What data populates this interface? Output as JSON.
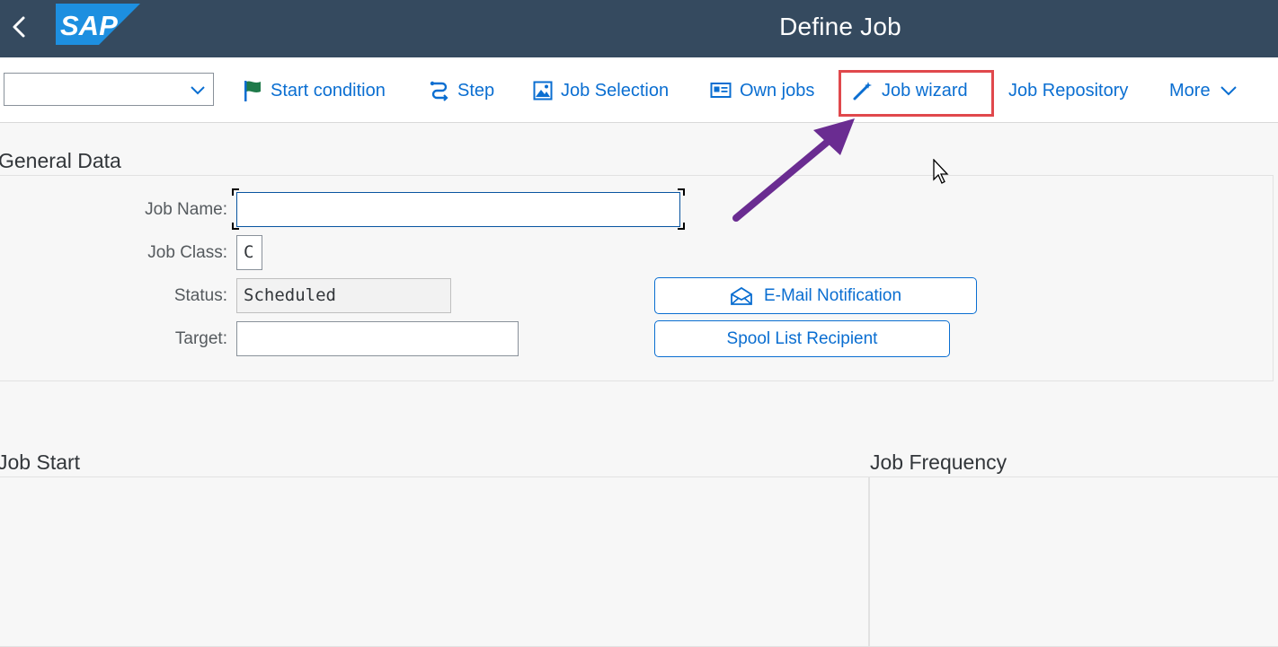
{
  "shell": {
    "title": "Define Job",
    "logo_text": "SAP",
    "colors": {
      "shellbar": "#354a5f",
      "logo": "#1d8fe0",
      "link": "#0a6ed1",
      "highlight": "#e0484c",
      "annotation_arrow": "#6a2c91"
    }
  },
  "toolbar": {
    "select_value": "",
    "items": [
      {
        "label": "Start condition",
        "icon": "flag-icon"
      },
      {
        "label": "Step",
        "icon": "step-icon"
      },
      {
        "label": "Job Selection",
        "icon": "image-icon"
      },
      {
        "label": "Own jobs",
        "icon": "id-card-icon"
      },
      {
        "label": "Job wizard",
        "icon": "magic-wand-icon"
      },
      {
        "label": "Job Repository",
        "icon": ""
      },
      {
        "label": "More",
        "icon": "chevron-down-icon"
      }
    ]
  },
  "general_data": {
    "title": "General Data",
    "job_name_label": "Job Name:",
    "job_name_value": "",
    "job_class_label": "Job Class:",
    "job_class_value": "C",
    "status_label": "Status:",
    "status_value": "Scheduled",
    "target_label": "Target:",
    "target_value": "",
    "email_button": "E-Mail Notification",
    "spool_button": "Spool List Recipient"
  },
  "job_start": {
    "title": "Job Start"
  },
  "job_frequency": {
    "title": "Job Frequency"
  }
}
